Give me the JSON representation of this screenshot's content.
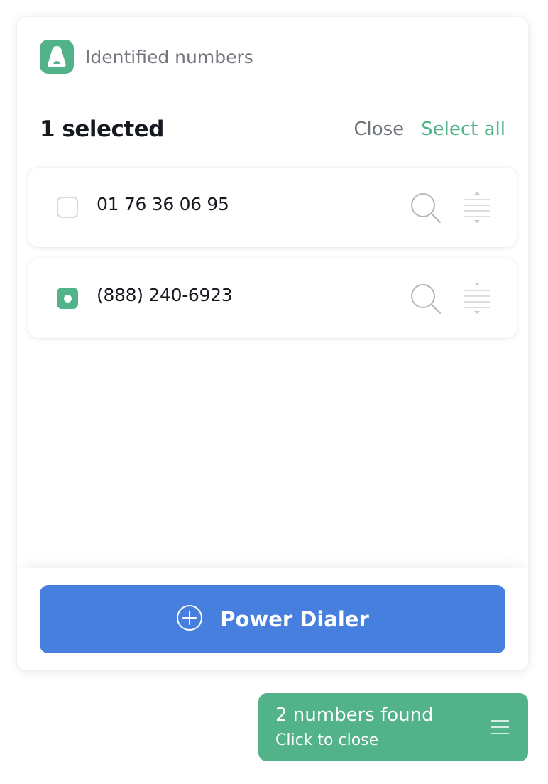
{
  "header": {
    "title": "Identified numbers",
    "logo_icon": "app-logo-icon"
  },
  "toolbar": {
    "selected_label": "1 selected",
    "close_label": "Close",
    "select_all_label": "Select all"
  },
  "numbers": [
    {
      "phone": "01 76 36 06 95",
      "selected": false
    },
    {
      "phone": "(888) 240-6923",
      "selected": true
    }
  ],
  "footer": {
    "dialer_label": "Power Dialer",
    "dialer_icon": "plus-circle-icon"
  },
  "toast": {
    "title": "2 numbers found",
    "subtitle": "Click to close",
    "icon": "menu-icon"
  },
  "colors": {
    "brand_green": "#52b289",
    "accent_blue": "#477fde",
    "text_dark": "#16191f",
    "text_gray": "#72767d"
  }
}
